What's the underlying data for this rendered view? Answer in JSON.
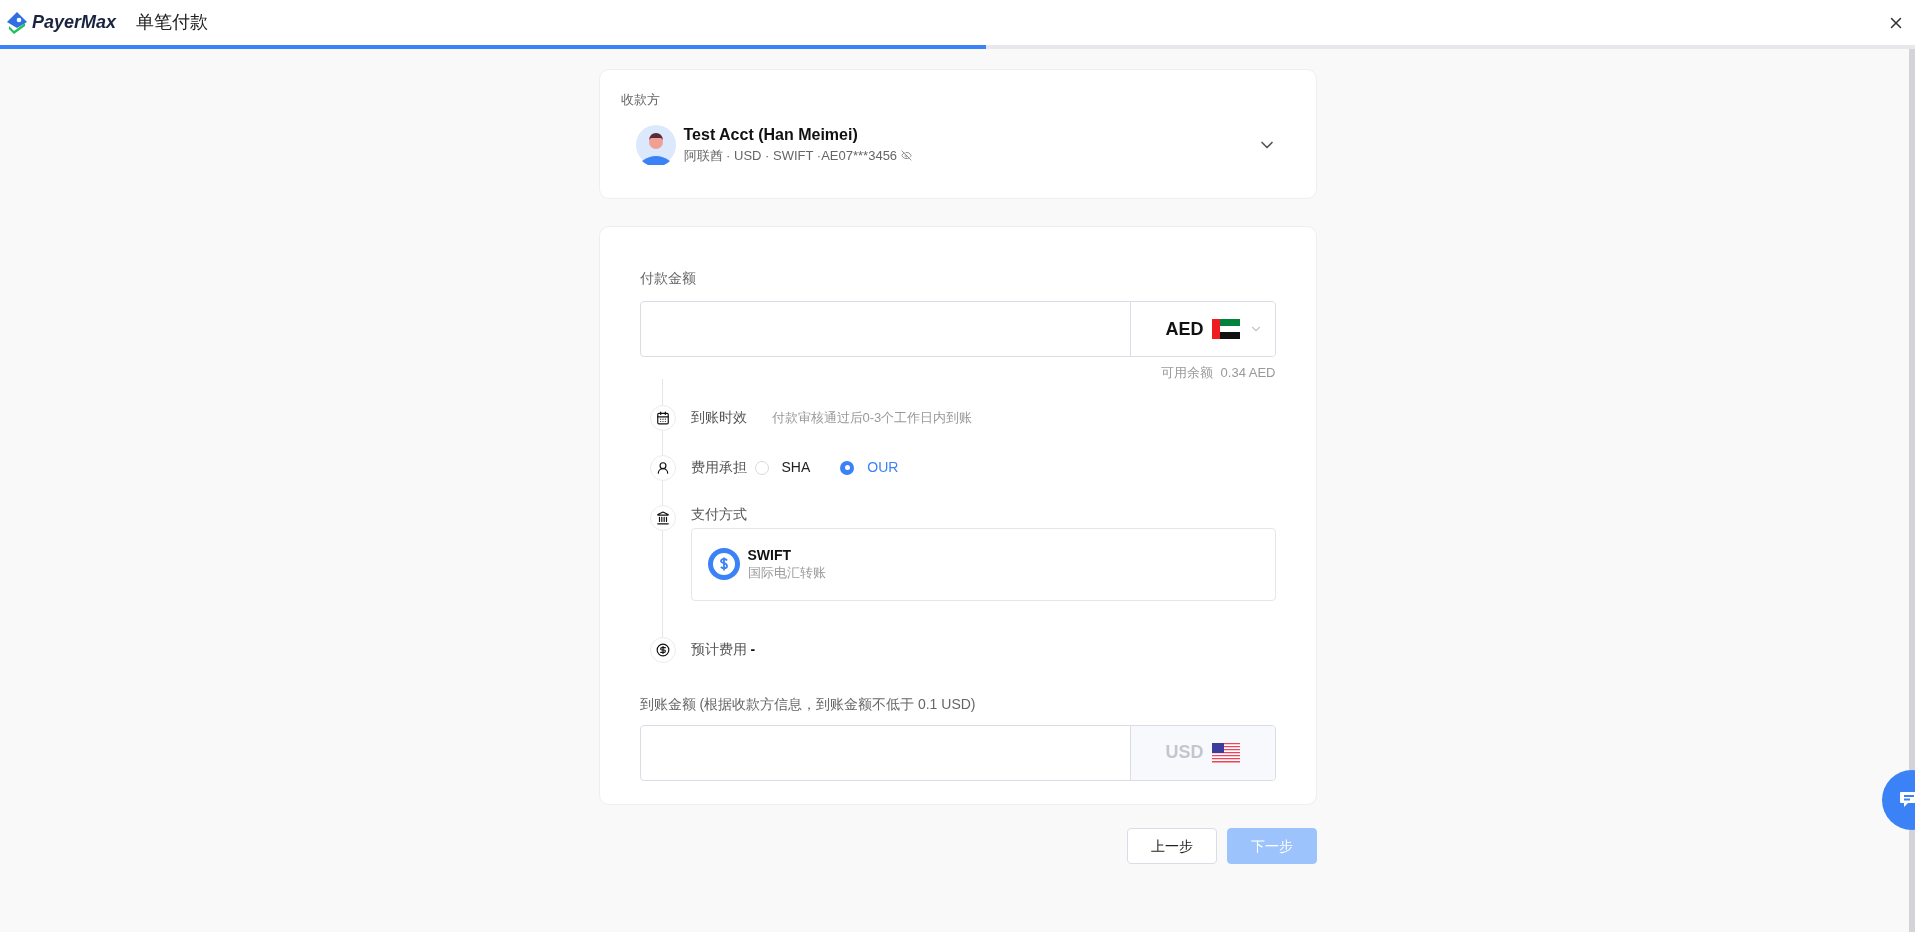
{
  "header": {
    "logo_text": "PayerMax",
    "title": "单笔付款",
    "progress": {
      "level": 0.515
    }
  },
  "payee": {
    "label": "收款方",
    "name": "Test Acct (Han Meimei)",
    "details": "阿联酋 · USD · SWIFT ·AE07***3456"
  },
  "payment": {
    "label": "付款金额",
    "currency": {
      "code": "AED",
      "kind": "ae",
      "disabled": false
    },
    "balance_label": "可用余额",
    "balance": "0.34 AED"
  },
  "steps": [
    {
      "kind": "timing",
      "label": "到账时效",
      "value": "付款审核通过后0-3个工作日内到账"
    },
    {
      "kind": "fee_bearer",
      "label": "费用承担",
      "options": [
        {
          "label": "SHA",
          "selected": false
        },
        {
          "label": "OUR",
          "selected": true
        }
      ]
    },
    {
      "kind": "method",
      "label": "支付方式",
      "method": {
        "name": "SWIFT",
        "description": "国际电汇转账"
      }
    },
    {
      "kind": "fee",
      "label": "预计费用",
      "value": "-"
    }
  ],
  "receive": {
    "label": "到账金额 (根据收款方信息，到账金额不低于 0.1 USD)",
    "currency": {
      "code": "USD",
      "kind": "us",
      "disabled": true
    }
  },
  "buttons": [
    {
      "label": "上一步",
      "kind": "secondary",
      "disabled": false
    },
    {
      "label": "下一步",
      "kind": "primary",
      "disabled": true
    }
  ]
}
